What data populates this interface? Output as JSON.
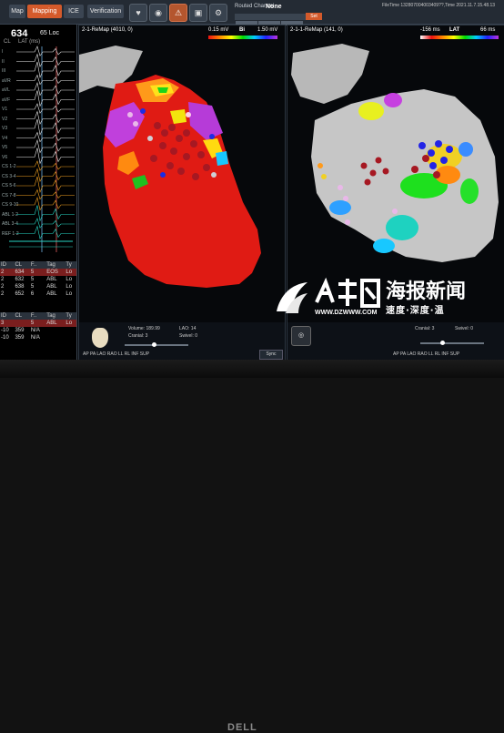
{
  "toolbar": {
    "tabs": [
      "Map",
      "Mapping",
      "ICE",
      "Verification"
    ],
    "routed_channel_label": "Routed Channel",
    "routed_channel_value": "None",
    "set_label": "Set",
    "file_time": "FileTime 132807004003409??,Time 2021.11.7.15.48.13"
  },
  "ecg": {
    "heart_rate": "634",
    "loc": "65 Loc",
    "cl_label": "CL",
    "lat_label": "LAT (ms)",
    "leads": [
      "I",
      "II",
      "III",
      "aVR",
      "aVL",
      "aVF",
      "V1",
      "V2",
      "V3",
      "V4",
      "V5",
      "V6",
      "CS 1-2",
      "CS 3-4",
      "CS 5-6",
      "CS 7-8",
      "CS 9-10",
      "ABL 1-2",
      "ABL 3-4",
      "REF 1-2"
    ],
    "table": {
      "headers": [
        "ID",
        "CL",
        "F..",
        "Tag",
        "Ty"
      ],
      "rows": [
        {
          "id": "2",
          "cl": "634",
          "f": "5",
          "tag": "EOS",
          "ty": "Lo"
        },
        {
          "id": "2",
          "cl": "632",
          "f": "5",
          "tag": "ABL",
          "ty": "Lo"
        },
        {
          "id": "2",
          "cl": "638",
          "f": "5",
          "tag": "ABL",
          "ty": "Lo"
        },
        {
          "id": "2",
          "cl": "652",
          "f": "6",
          "tag": "ABL",
          "ty": "Lo"
        }
      ],
      "headers2": [
        "ID",
        "CL",
        "F..",
        "Tag",
        "Ty"
      ],
      "rows2": [
        {
          "id": "3",
          "cl": "",
          "f": "5",
          "tag": "ABL",
          "ty": "Lo"
        },
        {
          "id": "-10",
          "cl": "359",
          "f": "N/A",
          "tag": "",
          "ty": ""
        },
        {
          "id": "-10",
          "cl": "359",
          "f": "N/A",
          "tag": "",
          "ty": ""
        }
      ]
    }
  },
  "left_map": {
    "title": "2-1-ReMap (4010, 0)",
    "scale_min": "0.15 mV",
    "scale_label": "Bi",
    "scale_max": "1.50 mV",
    "volume_label": "Volume:",
    "volume_value": "189.99",
    "lao_label": "LAO:",
    "lao_value": "14",
    "cranial_label": "Cranial:",
    "cranial_value": "3",
    "swivel_label": "Swivel:",
    "swivel_value": "0",
    "views": "AP PA LAO RAO LL RL INF SUP",
    "sync_label": "Sync"
  },
  "right_map": {
    "title": "2-1-1-ReMap (141, 0)",
    "scale_min": "-156 ms",
    "scale_label": "LAT",
    "scale_max": "66 ms",
    "cranial_label": "Cranial:",
    "cranial_value": "3",
    "swivel_label": "Swivel:",
    "swivel_value": "0",
    "views": "AP PA LAO RAO LL RL INF SUP"
  },
  "watermark": {
    "site": "WWW.DZWWW.COM",
    "title": "海报新闻",
    "subtitle": "速度·深度·温"
  },
  "monitor_brand": "DELL",
  "colors": {
    "accent": "#d45a2b",
    "voltage_low": "#e61e1e",
    "voltage_high": "#b43cdc",
    "lesion": "#b01a22"
  }
}
